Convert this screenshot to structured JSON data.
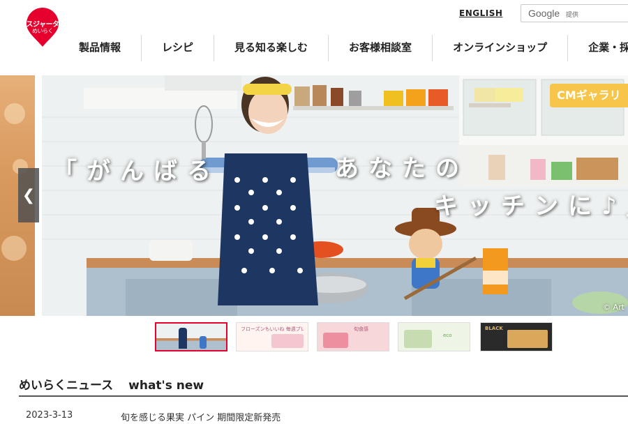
{
  "header": {
    "logo": {
      "line1": "スジャータ",
      "line2": "めいらく"
    },
    "english_link": "ENGLISH",
    "search": {
      "brand": "Google",
      "provided": "提供"
    }
  },
  "nav": {
    "items": [
      {
        "label": "製品情報"
      },
      {
        "label": "レシピ"
      },
      {
        "label": "見る知る楽しむ"
      },
      {
        "label": "お客様相談室"
      },
      {
        "label": "オンラインショップ"
      },
      {
        "label": "企業・採"
      }
    ]
  },
  "hero": {
    "cm_badge": "CMギャラリ",
    "catch": [
      "「がんばる",
      "あなたの",
      "キッチンに♪」"
    ],
    "copyright": "© Art"
  },
  "thumbnails": [
    {
      "name": "CM kitchen",
      "caption": "",
      "active": true
    },
    {
      "name": "Campaign",
      "caption": "フローズンもいいね 毎週プレゼント",
      "active": false
    },
    {
      "name": "Seasonal",
      "caption": "旬食感",
      "active": false
    },
    {
      "name": "Eco",
      "caption": "eco",
      "active": false
    },
    {
      "name": "Black",
      "caption": "BLACK",
      "active": false
    }
  ],
  "news": {
    "heading": "めいらくニュース",
    "subheading": "what's new",
    "items": [
      {
        "date": "2023-3-13",
        "title": "旬を感じる果実 パイン 期間限定新発売"
      }
    ]
  },
  "colors": {
    "brand_red": "#e6002d",
    "badge_yellow": "#f6c54a",
    "arrow_bg": "#505050"
  }
}
